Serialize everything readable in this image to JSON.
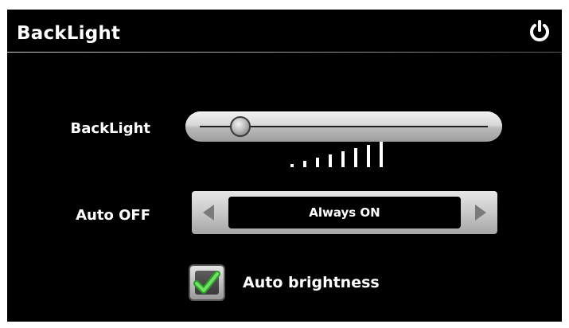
{
  "header": {
    "title": "BackLight",
    "power_icon": "power-icon"
  },
  "backlight": {
    "label": "BackLight",
    "level_fraction": 0.14,
    "level_bars": 8
  },
  "auto_off": {
    "label": "Auto OFF",
    "value": "Always ON",
    "prev_icon": "triangle-left-icon",
    "next_icon": "triangle-right-icon"
  },
  "auto_brightness": {
    "label": "Auto brightness",
    "checked": true,
    "check_icon": "checkmark-icon"
  },
  "colors": {
    "background": "#000000",
    "text": "#ffffff",
    "check_green": "#3fc23a"
  }
}
